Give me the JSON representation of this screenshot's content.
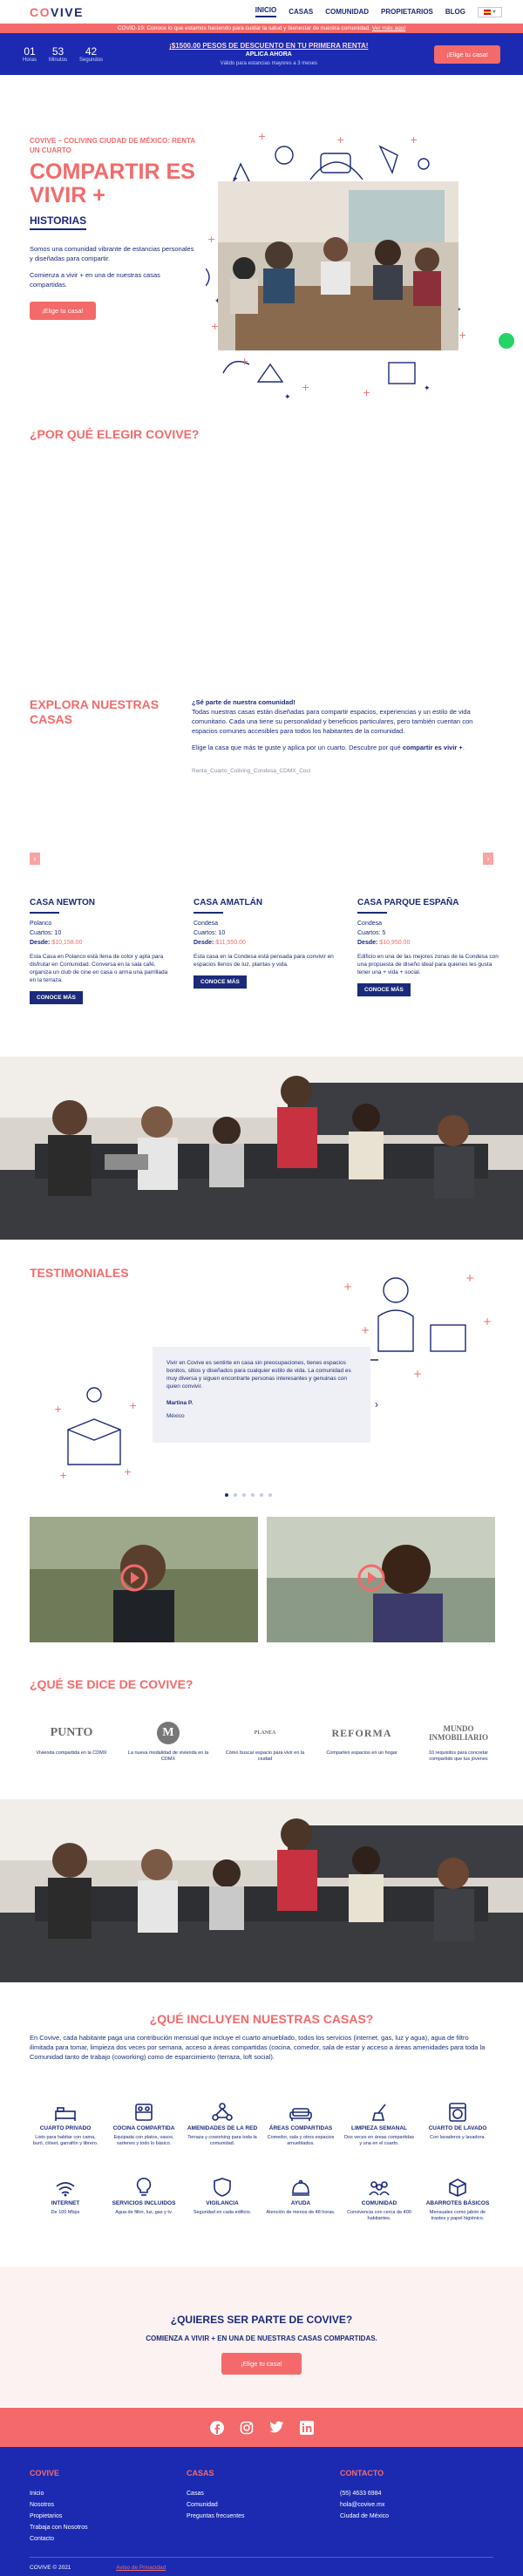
{
  "nav": {
    "logo": "COVIVE",
    "items": [
      "INICIO",
      "CASAS",
      "COMUNIDAD",
      "PROPIETARIOS",
      "BLOG"
    ],
    "lang": "ES"
  },
  "covid_bar": {
    "text": "COVID-19: Conoce lo que estamos haciendo para cuidar la salud y bienestar de nuestra comunidad.",
    "link": "Ver más aquí"
  },
  "promo": {
    "countdown": [
      {
        "value": "01",
        "label": "Horas"
      },
      {
        "value": "53",
        "label": "Minutos"
      },
      {
        "value": "42",
        "label": "Segundos"
      }
    ],
    "headline": "¡$1500.00 PESOS DE DESCUENTO EN TU PRIMERA RENTA!",
    "sub": "APLICA AHORA",
    "note": "Válido para estancias mayores a 3 meses",
    "button": "¡Elige tu casa!"
  },
  "hero": {
    "eyebrow": "COVIVE – COLIVING CIUDAD DE MÉXICO: RENTA UN CUARTO",
    "title": "COMPARTIR ES VIVIR +",
    "subtitle": "HISTORIAS",
    "p1": "Somos una comunidad vibrante de estancias personales y diseñadas para compartir.",
    "p2": "Comienza a vivir + en una de nuestras casas compartidas.",
    "button": "¡Elige tu casa!"
  },
  "why": {
    "title": "¿POR QUÉ ELEGIR COVIVE?"
  },
  "explore": {
    "title": "EXPLORA NUESTRAS CASAS",
    "question": "¿Sé parte de nuestra comunidad!",
    "p1": "Todas nuestras casas están diseñadas para compartir espacios, experiencias y un estilo de vida comunitario. Cada una tiene su personalidad y beneficios particulares, pero también cuentan con espacios comunes accesibles para todos los habitantes de la comunidad.",
    "p2_start": "Elige la casa que más te guste y aplica por un cuarto. Descubre por qué ",
    "p2_bold": "compartir es vivir +",
    "p2_end": ".",
    "alt": "Renta_Cuarto_Coliving_Condesa_CDMX_Cocí"
  },
  "houses": [
    {
      "name": "CASA NEWTON",
      "area": "Polanco",
      "rooms_label": "Cuartos:",
      "rooms": "10",
      "from_label": "Desde:",
      "price": "$10,158.00",
      "desc": "Esta Casa en Polanco está llena de color y apta para disfrutar en Comunidad. Conversa en la sala café, organiza un club de cine en casa o arma una parrillada en la terraza.",
      "button": "CONOCE MÁS"
    },
    {
      "name": "CASA AMATLÁN",
      "area": "Condesa",
      "rooms_label": "Cuartos:",
      "rooms": "10",
      "from_label": "Desde:",
      "price": "$11,550.00",
      "desc": "Esta casa en la Condesa está pensada para convivir en espacios llenos de luz, plantas y vida.",
      "button": "CONOCE MÁS"
    },
    {
      "name": "CASA PARQUE ESPAÑA",
      "area": "Condesa",
      "rooms_label": "Cuartos:",
      "rooms": "5",
      "from_label": "Desde:",
      "price": "$10,950.00",
      "desc": "Edificio en una de las mejores zonas de la Condesa con una propuesta de diseño ideal para quienes les gusta tener una + vida + social.",
      "button": "CONOCE MÁS"
    }
  ],
  "testimonials": {
    "title": "TESTIMONIALES",
    "quote": "Vivir en Covive es sentirte en casa sin preocupaciones, tienes espacios bonitos, sitios y diseñados para cualquier estilo de vida. La comunidad es muy diversa y siguen encontrarte personas interesantes y genuinas con quien convivir.",
    "name": "Martina P.",
    "place": "México"
  },
  "press": {
    "title": "¿QUÉ SE DICE DE COVIVE?",
    "items": [
      {
        "logo": "PUNTO",
        "caption": "Vivienda compartida en la CDMX"
      },
      {
        "logo": "M",
        "caption": "La nueva modalidad de vivienda en la CDMX"
      },
      {
        "logo": "PLANEA",
        "caption": "Cómo buscar espacio para vivir en la ciudad"
      },
      {
        "logo": "REFORMA",
        "caption": "Comparten espacios en un hogar"
      },
      {
        "logo": "MUNDO INMOBILIARIO",
        "caption": "10 requisitos para concretar compartido que tus jóvenes"
      }
    ]
  },
  "include": {
    "title": "¿QUÉ INCLUYEN NUESTRAS CASAS?",
    "p": "En Covive, cada habitante paga una contribución mensual que incluye el cuarto amueblado, todos los servicios (internet, gas, luz y agua), agua de filtro ilimitada para tomar, limpieza dos veces por semana, acceso a áreas compartidas (cocina, comedor, sala de estar y acceso a áreas amenidades para toda la Comunidad tanto de trabajo (coworking) como de esparcimiento (terraza, loft social).",
    "row1": [
      {
        "icon": "bed-icon",
        "title": "CUARTO PRIVADO",
        "desc": "Listo para habitar con cama, buró, clóset, garrafón y librero."
      },
      {
        "icon": "kitchen-icon",
        "title": "COCINA COMPARTIDA",
        "desc": "Equipada con platos, vasos, sartenes y todo lo básico."
      },
      {
        "icon": "network-icon",
        "title": "AMENIDADES DE LA RED",
        "desc": "Terraza y coworking para toda la comunidad."
      },
      {
        "icon": "sofa-icon",
        "title": "ÁREAS COMPARTIDAS",
        "desc": "Comedor, sala y otros espacios amueblados."
      },
      {
        "icon": "broom-icon",
        "title": "LIMPIEZA SEMANAL",
        "desc": "Dos veces en áreas compartidas y una en el cuarto."
      },
      {
        "icon": "washer-icon",
        "title": "CUARTO DE LAVADO",
        "desc": "Con lavaderos y lavadora."
      }
    ],
    "row2": [
      {
        "icon": "wifi-icon",
        "title": "INTERNET",
        "desc": "De 100 Mbps"
      },
      {
        "icon": "bulb-icon",
        "title": "SERVICIOS INCLUIDOS",
        "desc": "Agua de filtro, luz, gas y tv."
      },
      {
        "icon": "shield-icon",
        "title": "VIGILANCIA",
        "desc": "Seguridad en cada edificio."
      },
      {
        "icon": "bell-icon",
        "title": "AYUDA",
        "desc": "Atención de menos de 48 horas."
      },
      {
        "icon": "community-icon",
        "title": "COMUNIDAD",
        "desc": "Convivencia con cerca de 400 habitantes."
      },
      {
        "icon": "box-icon",
        "title": "ABARROTES BÁSICOS",
        "desc": "Mensuales como jabón de trastes y papel higiénico."
      }
    ]
  },
  "cta": {
    "title": "¿QUIERES SER PARTE DE COVIVE?",
    "sub": "COMIENZA A VIVIR + EN UNA DE NUESTRAS CASAS COMPARTIDAS.",
    "button": "¡Elige tu casa!"
  },
  "social": [
    "facebook-icon",
    "instagram-icon",
    "twitter-icon",
    "linkedin-icon"
  ],
  "footer": {
    "col1": {
      "heading": "COVIVE",
      "links": [
        "Inicio",
        "Nosotros",
        "Propietarios",
        "Trabaja con Nosotros",
        "Contacto"
      ]
    },
    "col2": {
      "heading": "CASAS",
      "links": [
        "Casas",
        "Comunidad",
        "Preguntas frecuentes"
      ]
    },
    "col3": {
      "heading": "CONTACTO",
      "links": [
        "(55) 4633 6984",
        "hola@covive.mx",
        "Ciudad de México"
      ]
    },
    "copyright": "COVIVE © 2021",
    "privacy": "Aviso de Privacidad"
  },
  "colors": {
    "coral": "#f46a6a",
    "navy": "#1b2a7a",
    "blue": "#1b2ab0"
  }
}
